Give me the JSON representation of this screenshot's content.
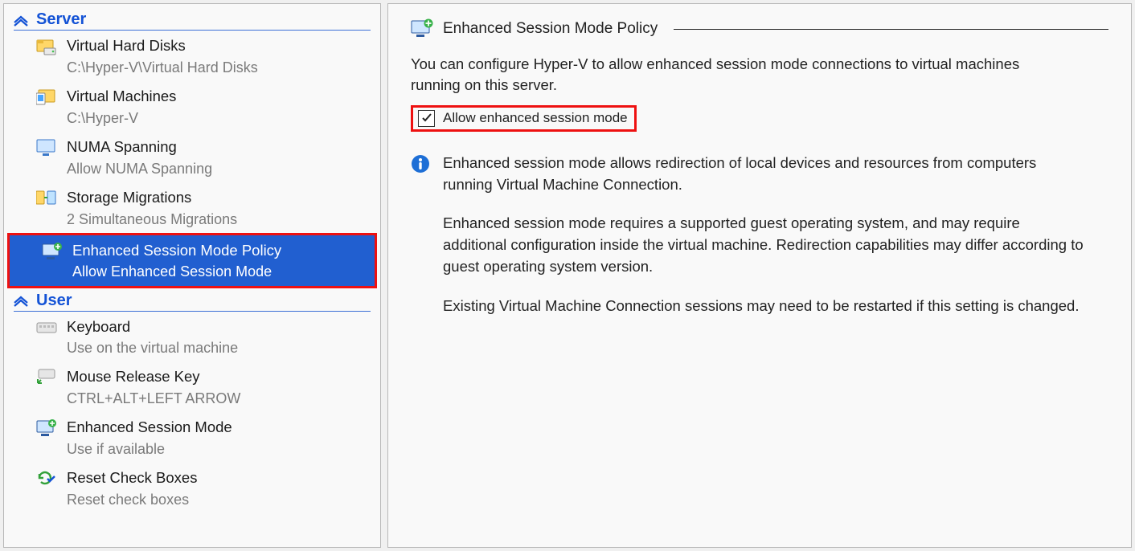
{
  "left": {
    "sections": {
      "server": {
        "label": "Server",
        "items": {
          "vhd": {
            "title": "Virtual Hard Disks",
            "sub": "C:\\Hyper-V\\Virtual Hard Disks"
          },
          "vms": {
            "title": "Virtual Machines",
            "sub": "C:\\Hyper-V"
          },
          "numa": {
            "title": "NUMA Spanning",
            "sub": "Allow NUMA Spanning"
          },
          "stor": {
            "title": "Storage Migrations",
            "sub": "2 Simultaneous Migrations"
          },
          "esmp": {
            "title": "Enhanced Session Mode Policy",
            "sub": "Allow Enhanced Session Mode"
          }
        }
      },
      "user": {
        "label": "User",
        "items": {
          "kbd": {
            "title": "Keyboard",
            "sub": "Use on the virtual machine"
          },
          "mrk": {
            "title": "Mouse Release Key",
            "sub": "CTRL+ALT+LEFT ARROW"
          },
          "esm": {
            "title": "Enhanced Session Mode",
            "sub": "Use if available"
          },
          "rcb": {
            "title": "Reset Check Boxes",
            "sub": "Reset check boxes"
          }
        }
      }
    }
  },
  "right": {
    "title": "Enhanced Session Mode Policy",
    "desc": "You can configure Hyper-V to allow enhanced session mode connections to virtual machines running on this server.",
    "checkbox_label": "Allow enhanced session mode",
    "info": {
      "p1": "Enhanced session mode allows redirection of local devices and resources from computers running Virtual Machine Connection.",
      "p2": "Enhanced session mode requires a supported guest operating system, and may require additional configuration inside the virtual machine. Redirection capabilities may differ according to guest operating system version.",
      "p3": "Existing Virtual Machine Connection sessions may need to be restarted if this setting is changed."
    }
  }
}
